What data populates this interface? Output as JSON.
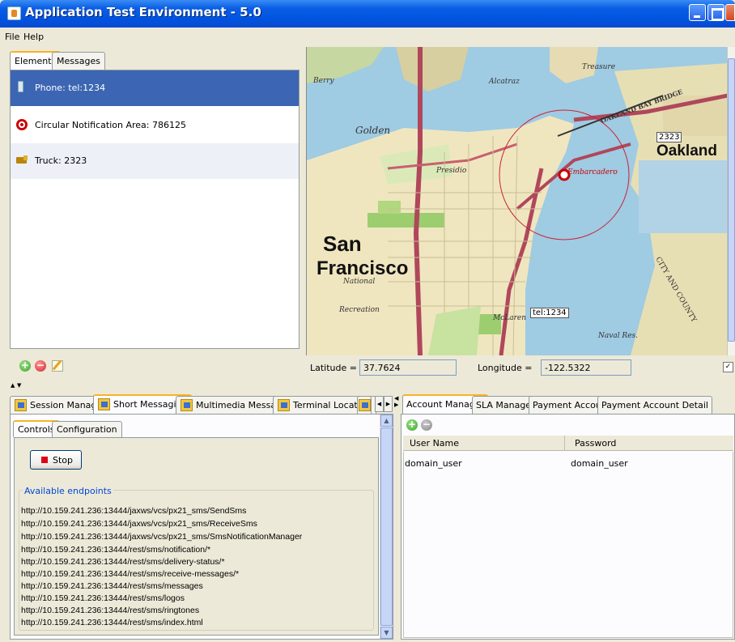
{
  "window": {
    "title": "Application Test Environment - 5.0"
  },
  "menu": {
    "items": [
      "File",
      "Help"
    ]
  },
  "left_tabs": [
    "Elements",
    "Messages"
  ],
  "elements": [
    {
      "label": "Phone: tel:1234",
      "icon": "phone-icon"
    },
    {
      "label": "Circular Notification Area: 786125",
      "icon": "target-icon"
    },
    {
      "label": "Truck: 2323",
      "icon": "truck-icon"
    }
  ],
  "map": {
    "labels": {
      "san": "San",
      "francisco": "Francisco",
      "oakland": "Oakland",
      "golden": "Golden",
      "treasure": "Treasure",
      "alcatraz": "Alcatraz",
      "presidio": "Presidio",
      "embarcadero": "Embarcadero",
      "mclaren": "McLaren",
      "naval_res": "Naval Res.",
      "berry": "Berry",
      "recreation": "Recreation",
      "national": "National",
      "bay_bridge": "OAKLAND BAY BRIDGE",
      "county": "CITY AND COUNTY"
    },
    "markers": {
      "truck": "2323",
      "phone": "tel:1234"
    }
  },
  "coords": {
    "latitude_label": "Latitude =",
    "latitude_value": "37.7624",
    "longitude_label": "Longitude =",
    "longitude_value": "-122.5322"
  },
  "bottom_left": {
    "tabs": [
      "Session Manager",
      "Short Messaging",
      "Multimedia Messaging",
      "Terminal Location"
    ],
    "inner_tabs": [
      "Controls",
      "Configuration"
    ],
    "stop_label": "Stop",
    "endpoints_legend": "Available endpoints",
    "endpoints": [
      "http://10.159.241.236:13444/jaxws/vcs/px21_sms/SendSms",
      "http://10.159.241.236:13444/jaxws/vcs/px21_sms/ReceiveSms",
      "http://10.159.241.236:13444/jaxws/vcs/px21_sms/SmsNotificationManager",
      "http://10.159.241.236:13444/rest/sms/notification/*",
      "http://10.159.241.236:13444/rest/sms/delivery-status/*",
      "http://10.159.241.236:13444/rest/sms/receive-messages/*",
      "http://10.159.241.236:13444/rest/sms/messages",
      "http://10.159.241.236:13444/rest/sms/logos",
      "http://10.159.241.236:13444/rest/sms/ringtones",
      "http://10.159.241.236:13444/rest/sms/index.html"
    ]
  },
  "bottom_right": {
    "tabs": [
      "Account Manager",
      "SLA Manager",
      "Payment Account",
      "Payment Account Detail"
    ],
    "columns": [
      "User Name",
      "Password"
    ],
    "rows": [
      [
        "domain_user",
        "domain_user"
      ]
    ]
  }
}
